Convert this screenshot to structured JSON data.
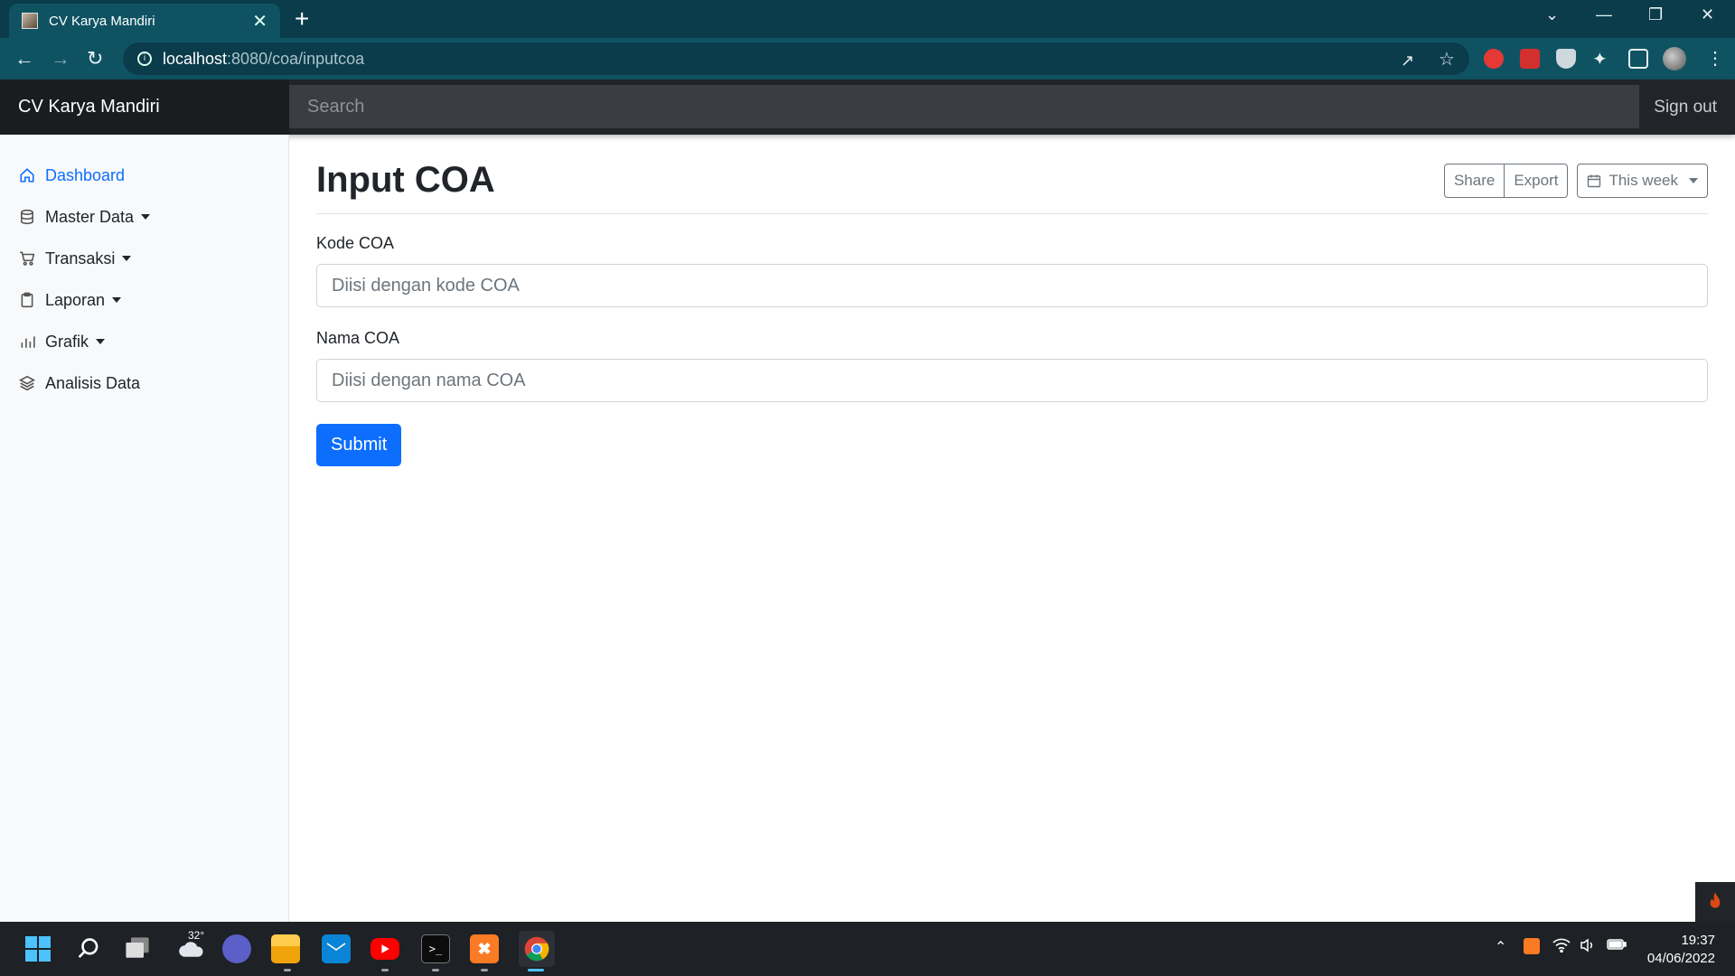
{
  "browser": {
    "tab_title": "CV Karya Mandiri",
    "tab_close": "✕",
    "new_tab": "+",
    "url_host": "localhost",
    "url_path": ":8080/coa/inputcoa"
  },
  "navbar": {
    "brand": "CV Karya Mandiri",
    "search_placeholder": "Search",
    "sign_out": "Sign out"
  },
  "sidebar": {
    "items": [
      {
        "label": "Dashboard",
        "icon": "home-icon",
        "active": true
      },
      {
        "label": "Master Data",
        "icon": "database-icon",
        "dropdown": true
      },
      {
        "label": "Transaksi",
        "icon": "cart-icon",
        "dropdown": true
      },
      {
        "label": "Laporan",
        "icon": "clipboard-icon",
        "dropdown": true
      },
      {
        "label": "Grafik",
        "icon": "bar-chart-icon",
        "dropdown": true
      },
      {
        "label": "Analisis Data",
        "icon": "layers-icon"
      }
    ]
  },
  "main": {
    "title": "Input COA",
    "share_label": "Share",
    "export_label": "Export",
    "period_label": "This week"
  },
  "form": {
    "kode_label": "Kode COA",
    "kode_placeholder": "Diisi dengan kode COA",
    "kode_value": "",
    "nama_label": "Nama COA",
    "nama_placeholder": "Diisi dengan nama COA",
    "nama_value": "",
    "submit_label": "Submit"
  },
  "taskbar": {
    "weather_temp": "32°",
    "time": "19:37",
    "date": "04/06/2022"
  },
  "colors": {
    "primary": "#0d6efd",
    "navbar": "#212529",
    "browser_frame": "#0b3c4c"
  }
}
